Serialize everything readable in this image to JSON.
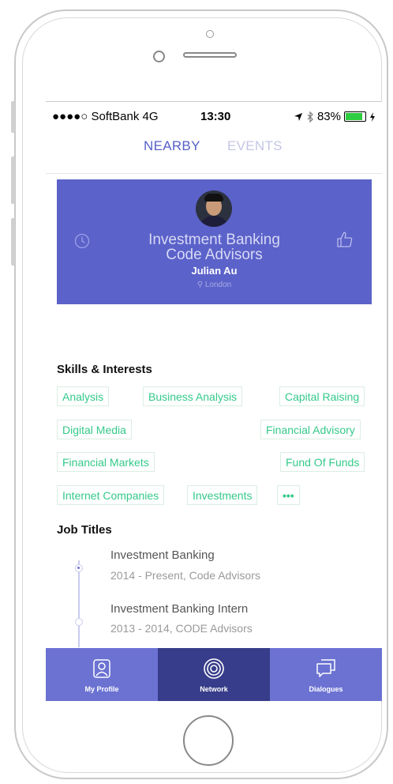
{
  "status_bar": {
    "carrier": "●●●●○ SoftBank  4G",
    "time": "13:30",
    "battery": "83%",
    "battery_level": 0.83
  },
  "tabs": [
    {
      "label": "NEARBY",
      "active": true
    },
    {
      "label": "EVENTS",
      "active": false
    }
  ],
  "profile": {
    "title_line1": "Investment Banking",
    "title_line2": "Code Advisors",
    "name": "Julian Au",
    "location": "London",
    "accent_color": "#5b62c9"
  },
  "skills": {
    "heading": "Skills & Interests",
    "items": [
      "Analysis",
      "Business Analysis",
      "Capital Raising",
      "Digital Media",
      "Financial Advisory",
      "Financial Markets",
      "Fund Of Funds",
      "Internet Companies",
      "Investments",
      "•••"
    ]
  },
  "jobs": {
    "heading": "Job Titles",
    "items": [
      {
        "title": "Investment Banking",
        "detail": "2014 - Present, Code Advisors"
      },
      {
        "title": "Investment Banking Intern",
        "detail": "2013 - 2014, CODE Advisors"
      }
    ]
  },
  "bottom_nav": [
    {
      "label": "My Profile",
      "icon": "profile-icon",
      "active": false
    },
    {
      "label": "Network",
      "icon": "network-icon",
      "active": true
    },
    {
      "label": "Dialogues",
      "icon": "dialogues-icon",
      "active": false
    }
  ]
}
